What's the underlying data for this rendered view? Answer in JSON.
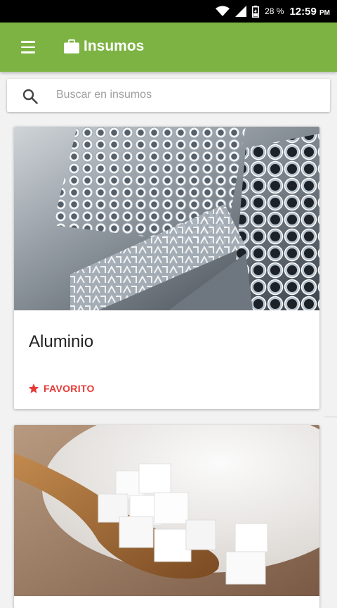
{
  "status_bar": {
    "battery": "28 %",
    "time": "12:59",
    "ampm": "PM"
  },
  "app_bar": {
    "title": "Insumos",
    "title_icon": "briefcase-icon",
    "menu_icon": "menu-icon"
  },
  "search": {
    "placeholder": "Buscar en insumos",
    "value": "",
    "icon": "search-icon"
  },
  "cards": [
    {
      "title": "Aluminio",
      "image": "aluminum-tubes-photo",
      "action_label": "FAVORITO",
      "action_icon": "star-icon"
    },
    {
      "title": "",
      "image": "sugar-cubes-photo"
    }
  ],
  "colors": {
    "app_bar": "#7cb342",
    "favorite": "#e53935",
    "status_bar": "#000000"
  }
}
